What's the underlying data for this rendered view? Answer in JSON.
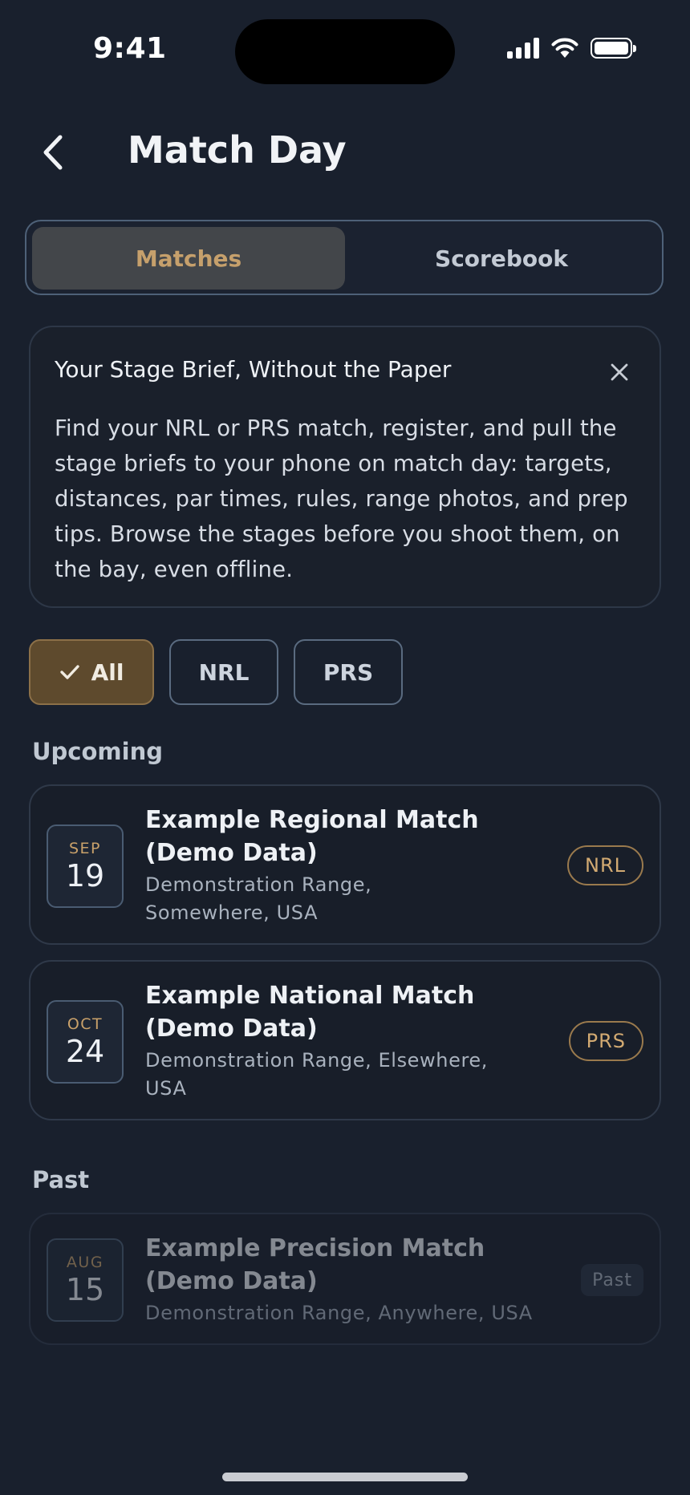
{
  "status_bar": {
    "time": "9:41"
  },
  "nav": {
    "title": "Match Day"
  },
  "segments": {
    "matches": "Matches",
    "scorebook": "Scorebook",
    "selected": "Matches"
  },
  "brief": {
    "title": "Your Stage Brief, Without the Paper",
    "body": "Find your NRL or PRS match, register, and pull the stage briefs to your phone on match day: targets, distances, par times, rules, range photos, and prep tips. Browse the stages before you shoot them, on the bay, even offline."
  },
  "filters": {
    "all": "All",
    "nrl": "NRL",
    "prs": "PRS",
    "selected": "All"
  },
  "sections": {
    "upcoming": "Upcoming",
    "past": "Past"
  },
  "matches": [
    {
      "month": "SEP",
      "day": "19",
      "name": "Example Regional Match (Demo Data)",
      "location": "Demonstration Range, Somewhere, USA",
      "badge": "NRL"
    },
    {
      "month": "OCT",
      "day": "24",
      "name": "Example National Match (Demo Data)",
      "location": "Demonstration Range, Elsewhere, USA",
      "badge": "PRS"
    },
    {
      "month": "AUG",
      "day": "15",
      "name": "Example Precision Match (Demo Data)",
      "location": "Demonstration Range, Anywhere, USA",
      "badge": "Past"
    }
  ],
  "colors": {
    "background": "#19202d",
    "accent": "#c6a06c",
    "selected_chip": "#5e4a2d"
  }
}
